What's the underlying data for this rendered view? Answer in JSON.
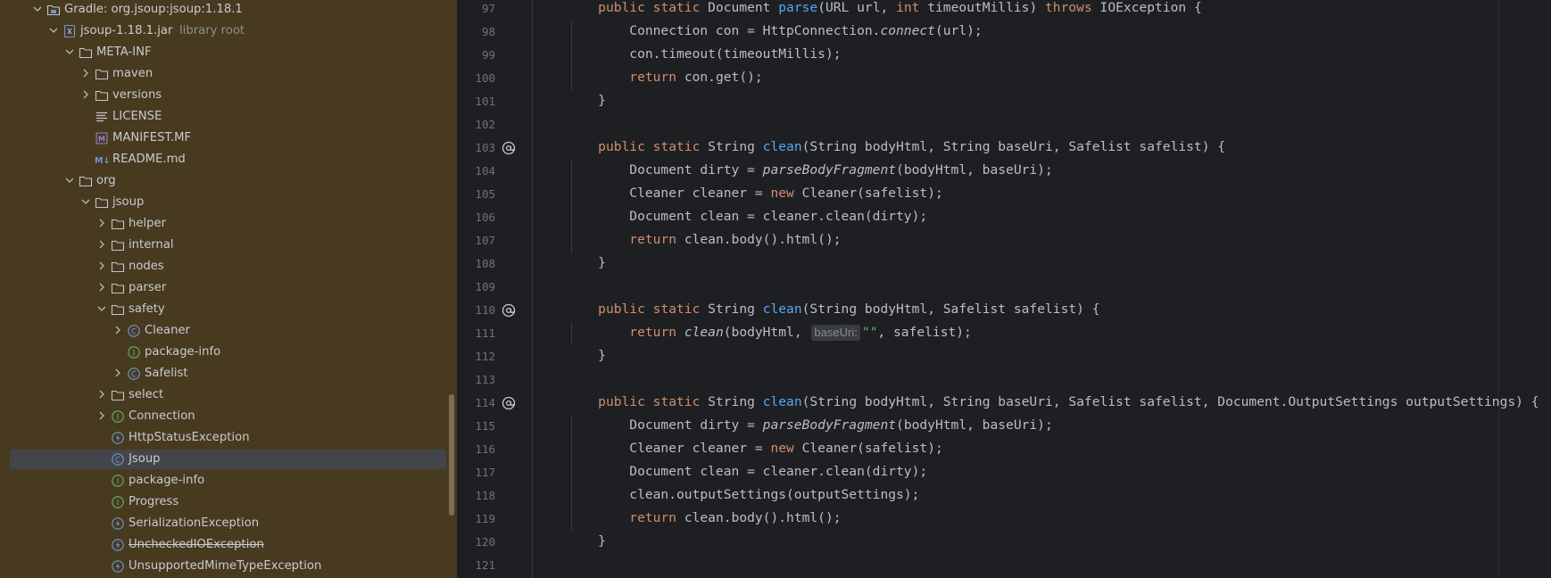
{
  "tree": {
    "items": [
      {
        "depth": 0,
        "expand": "open",
        "icon": "library",
        "label": "Gradle: org.jsoup:jsoup:1.18.1",
        "suffix": ""
      },
      {
        "depth": 1,
        "expand": "open",
        "icon": "jar",
        "label": "jsoup-1.18.1.jar",
        "suffix": "library root"
      },
      {
        "depth": 2,
        "expand": "open",
        "icon": "folder",
        "label": "META-INF",
        "suffix": ""
      },
      {
        "depth": 3,
        "expand": "closed",
        "icon": "folder",
        "label": "maven",
        "suffix": ""
      },
      {
        "depth": 3,
        "expand": "closed",
        "icon": "folder",
        "label": "versions",
        "suffix": ""
      },
      {
        "depth": 3,
        "expand": "none",
        "icon": "text-file",
        "label": "LICENSE",
        "suffix": ""
      },
      {
        "depth": 3,
        "expand": "none",
        "icon": "manifest",
        "label": "MANIFEST.MF",
        "suffix": ""
      },
      {
        "depth": 3,
        "expand": "none",
        "icon": "markdown",
        "label": "README.md",
        "suffix": ""
      },
      {
        "depth": 2,
        "expand": "open",
        "icon": "folder",
        "label": "org",
        "suffix": ""
      },
      {
        "depth": 3,
        "expand": "open",
        "icon": "folder",
        "label": "jsoup",
        "suffix": ""
      },
      {
        "depth": 4,
        "expand": "closed",
        "icon": "folder",
        "label": "helper",
        "suffix": ""
      },
      {
        "depth": 4,
        "expand": "closed",
        "icon": "folder",
        "label": "internal",
        "suffix": ""
      },
      {
        "depth": 4,
        "expand": "closed",
        "icon": "folder",
        "label": "nodes",
        "suffix": ""
      },
      {
        "depth": 4,
        "expand": "closed",
        "icon": "folder",
        "label": "parser",
        "suffix": ""
      },
      {
        "depth": 4,
        "expand": "open",
        "icon": "folder",
        "label": "safety",
        "suffix": ""
      },
      {
        "depth": 5,
        "expand": "closed",
        "icon": "class",
        "label": "Cleaner",
        "suffix": ""
      },
      {
        "depth": 5,
        "expand": "none",
        "icon": "interface",
        "label": "package-info",
        "suffix": ""
      },
      {
        "depth": 5,
        "expand": "closed",
        "icon": "class",
        "label": "Safelist",
        "suffix": ""
      },
      {
        "depth": 4,
        "expand": "closed",
        "icon": "folder",
        "label": "select",
        "suffix": ""
      },
      {
        "depth": 4,
        "expand": "closed",
        "icon": "interface",
        "label": "Connection",
        "suffix": ""
      },
      {
        "depth": 4,
        "expand": "none",
        "icon": "exception",
        "label": "HttpStatusException",
        "suffix": ""
      },
      {
        "depth": 4,
        "expand": "none",
        "icon": "class",
        "label": "Jsoup",
        "suffix": "",
        "selected": true
      },
      {
        "depth": 4,
        "expand": "none",
        "icon": "interface",
        "label": "package-info",
        "suffix": ""
      },
      {
        "depth": 4,
        "expand": "none",
        "icon": "interface",
        "label": "Progress",
        "suffix": ""
      },
      {
        "depth": 4,
        "expand": "none",
        "icon": "exception",
        "label": "SerializationException",
        "suffix": ""
      },
      {
        "depth": 4,
        "expand": "none",
        "icon": "exception",
        "label": "UncheckedIOException",
        "suffix": "",
        "strike": true
      },
      {
        "depth": 4,
        "expand": "none",
        "icon": "exception",
        "label": "UnsupportedMimeTypeException",
        "suffix": ""
      }
    ]
  },
  "editor": {
    "lines": [
      {
        "num": "97",
        "ann": false,
        "tokens": [
          [
            "    ",
            ""
          ],
          [
            "public static ",
            "kw"
          ],
          [
            "Document ",
            ""
          ],
          [
            "parse",
            "fn"
          ],
          [
            "(URL url, ",
            ""
          ],
          [
            "int ",
            "kw"
          ],
          [
            "timeoutMillis) ",
            ""
          ],
          [
            "throws ",
            "kw"
          ],
          [
            "IOException {",
            ""
          ]
        ]
      },
      {
        "num": "98",
        "ann": false,
        "tokens": [
          [
            "        Connection con = HttpConnection.",
            ""
          ],
          [
            "connect",
            "it"
          ],
          [
            "(url);",
            ""
          ]
        ]
      },
      {
        "num": "99",
        "ann": false,
        "tokens": [
          [
            "        con.timeout(timeoutMillis);",
            ""
          ]
        ]
      },
      {
        "num": "100",
        "ann": false,
        "tokens": [
          [
            "        ",
            ""
          ],
          [
            "return ",
            "kw"
          ],
          [
            "con.get();",
            ""
          ]
        ]
      },
      {
        "num": "101",
        "ann": false,
        "tokens": [
          [
            "    }",
            ""
          ]
        ]
      },
      {
        "num": "102",
        "ann": false,
        "tokens": []
      },
      {
        "num": "103",
        "ann": true,
        "tokens": [
          [
            "    ",
            ""
          ],
          [
            "public static ",
            "kw"
          ],
          [
            "String ",
            ""
          ],
          [
            "clean",
            "fn"
          ],
          [
            "(String bodyHtml, String baseUri, Safelist safelist) {",
            ""
          ]
        ]
      },
      {
        "num": "104",
        "ann": false,
        "tokens": [
          [
            "        Document dirty = ",
            ""
          ],
          [
            "parseBodyFragment",
            "it"
          ],
          [
            "(bodyHtml, baseUri);",
            ""
          ]
        ]
      },
      {
        "num": "105",
        "ann": false,
        "tokens": [
          [
            "        Cleaner cleaner = ",
            ""
          ],
          [
            "new ",
            "kw"
          ],
          [
            "Cleaner(safelist);",
            ""
          ]
        ]
      },
      {
        "num": "106",
        "ann": false,
        "tokens": [
          [
            "        Document clean = cleaner.clean(dirty);",
            ""
          ]
        ]
      },
      {
        "num": "107",
        "ann": false,
        "tokens": [
          [
            "        ",
            ""
          ],
          [
            "return ",
            "kw"
          ],
          [
            "clean.body().html();",
            ""
          ]
        ]
      },
      {
        "num": "108",
        "ann": false,
        "tokens": [
          [
            "    }",
            ""
          ]
        ]
      },
      {
        "num": "109",
        "ann": false,
        "tokens": []
      },
      {
        "num": "110",
        "ann": true,
        "tokens": [
          [
            "    ",
            ""
          ],
          [
            "public static ",
            "kw"
          ],
          [
            "String ",
            ""
          ],
          [
            "clean",
            "fn"
          ],
          [
            "(String bodyHtml, Safelist safelist) {",
            ""
          ]
        ]
      },
      {
        "num": "111",
        "ann": false,
        "tokens": [
          [
            "        ",
            ""
          ],
          [
            "return ",
            "kw"
          ],
          [
            "clean",
            "it"
          ],
          [
            "(bodyHtml, ",
            ""
          ],
          [
            "baseUri:",
            "hint"
          ],
          [
            "\"\"",
            "str"
          ],
          [
            ", safelist);",
            ""
          ]
        ]
      },
      {
        "num": "112",
        "ann": false,
        "tokens": [
          [
            "    }",
            ""
          ]
        ]
      },
      {
        "num": "113",
        "ann": false,
        "tokens": []
      },
      {
        "num": "114",
        "ann": true,
        "tokens": [
          [
            "    ",
            ""
          ],
          [
            "public static ",
            "kw"
          ],
          [
            "String ",
            ""
          ],
          [
            "clean",
            "fn"
          ],
          [
            "(String bodyHtml, String baseUri, Safelist safelist, Document.OutputSettings outputSettings) {",
            ""
          ]
        ]
      },
      {
        "num": "115",
        "ann": false,
        "tokens": [
          [
            "        Document dirty = ",
            ""
          ],
          [
            "parseBodyFragment",
            "it"
          ],
          [
            "(bodyHtml, baseUri);",
            ""
          ]
        ]
      },
      {
        "num": "116",
        "ann": false,
        "tokens": [
          [
            "        Cleaner cleaner = ",
            ""
          ],
          [
            "new ",
            "kw"
          ],
          [
            "Cleaner(safelist);",
            ""
          ]
        ]
      },
      {
        "num": "117",
        "ann": false,
        "tokens": [
          [
            "        Document clean = cleaner.clean(dirty);",
            ""
          ]
        ]
      },
      {
        "num": "118",
        "ann": false,
        "tokens": [
          [
            "        clean.outputSettings(outputSettings);",
            ""
          ]
        ]
      },
      {
        "num": "119",
        "ann": false,
        "tokens": [
          [
            "        ",
            ""
          ],
          [
            "return ",
            "kw"
          ],
          [
            "clean.body().html();",
            ""
          ]
        ]
      },
      {
        "num": "120",
        "ann": false,
        "tokens": [
          [
            "    }",
            ""
          ]
        ]
      },
      {
        "num": "121",
        "ann": false,
        "tokens": []
      }
    ]
  },
  "colors": {
    "tree_background": "#483a1f",
    "editor_background": "#1e1f22",
    "keyword": "#cf8e6d",
    "function": "#56a8f5",
    "string": "#6aab73",
    "text": "#bcbec4",
    "line_number": "#6f737a",
    "selection": "#43454a"
  }
}
